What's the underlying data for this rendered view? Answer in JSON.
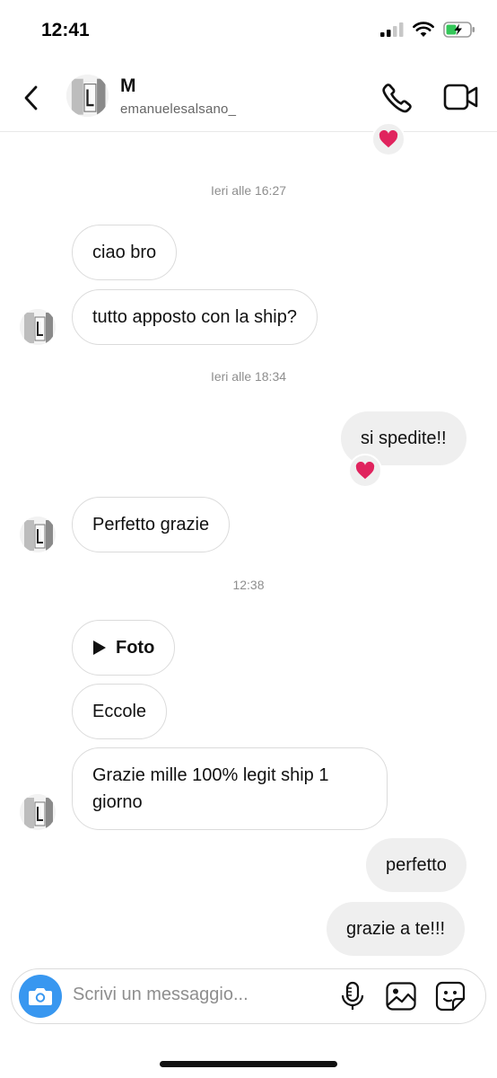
{
  "status_bar": {
    "time": "12:41"
  },
  "header": {
    "name": "M",
    "username": "emanuelesalsano_"
  },
  "messages": {
    "ts1": "Ieri alle 16:27",
    "m1": "ciao bro",
    "m2": "tutto apposto con la ship?",
    "ts2": "Ieri alle 18:34",
    "m3": "si spedite!!",
    "m4": "Perfetto grazie",
    "ts3": "12:38",
    "m5": "Foto",
    "m6": "Eccole",
    "m7": "Grazie mille 100% legit ship 1 giorno",
    "m8": "perfetto",
    "m9": "grazie a te!!!"
  },
  "composer": {
    "placeholder": "Scrivi un messaggio..."
  },
  "icons": {
    "back": "chevron-left-icon",
    "call": "phone-icon",
    "video": "video-camera-icon",
    "camera": "camera-icon",
    "mic": "microphone-icon",
    "gallery": "image-icon",
    "sticker": "sticker-icon",
    "reaction": "heart-emoji"
  },
  "colors": {
    "camera_button": "#3897f0",
    "heart": "#e0245e",
    "outgoing_bubble": "#efefef"
  }
}
